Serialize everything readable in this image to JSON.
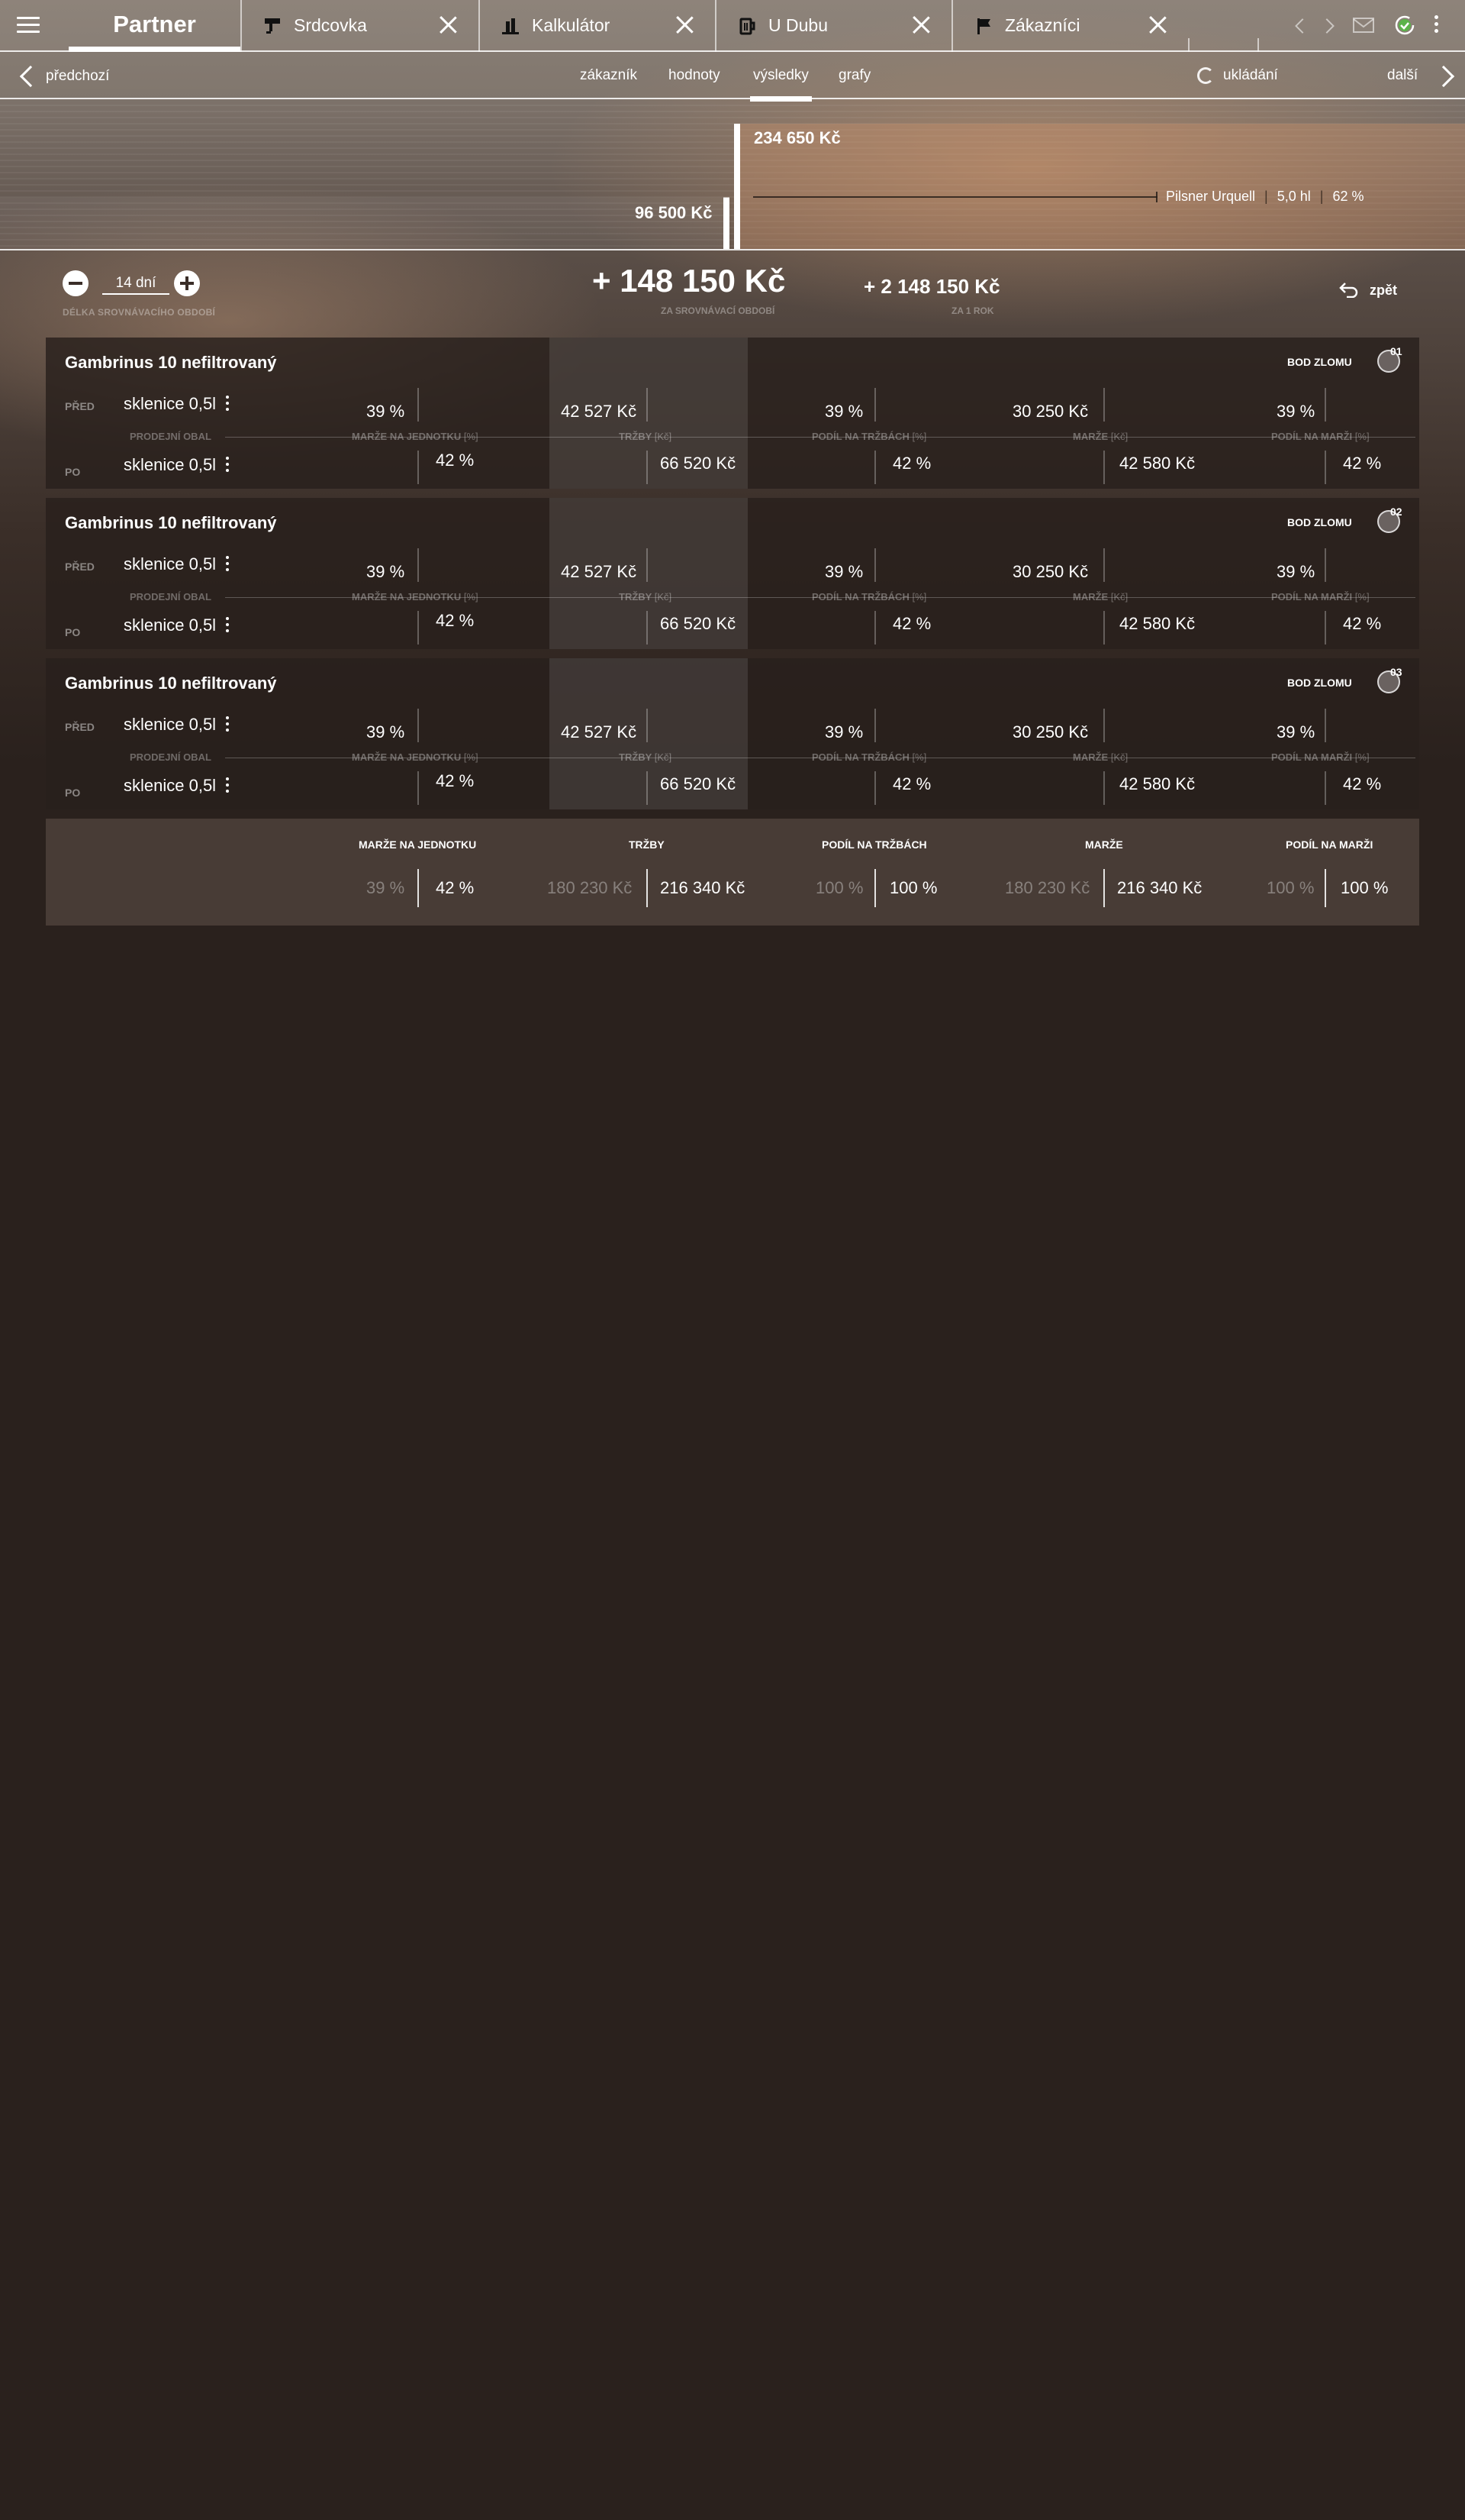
{
  "app": {
    "brand": "Partner",
    "tabs": [
      {
        "label": "Srdcovka",
        "icon": "tap-icon"
      },
      {
        "label": "Kalkulátor",
        "icon": "bar-chart-icon"
      },
      {
        "label": "U Dubu",
        "icon": "beer-mug-icon"
      },
      {
        "label": "Zákazníci",
        "icon": "flag-icon"
      }
    ],
    "header_icons": [
      "chevron-left-icon",
      "chevron-right-icon",
      "mail-icon",
      "sync-check-icon",
      "more-vertical-icon"
    ]
  },
  "subnav": {
    "prev_label": "předchozí",
    "items": [
      {
        "label": "zákazník",
        "active": false
      },
      {
        "label": "hodnoty",
        "active": false
      },
      {
        "label": "výsledky",
        "active": true
      },
      {
        "label": "grafy",
        "active": false
      }
    ],
    "saving_label": "ukládání",
    "next_label": "další"
  },
  "chart": {
    "before_value": "96 500 Kč",
    "after_value": "234 650 Kč",
    "before_amount": 96500,
    "after_amount": 234650,
    "legend": {
      "product": "Pilsner Urquell",
      "volume": "5,0 hl",
      "share": "62 %"
    }
  },
  "summary": {
    "period_value": "14 dní",
    "period_caption": "DÉLKA SROVNÁVACÍHO OBDOBÍ",
    "delta_value": "+ 148 150 Kč",
    "delta_caption": "ZA SROVNÁVACÍ OBDOBÍ",
    "year_value": "+ 2 148 150 Kč",
    "year_caption": "ZA 1 ROK",
    "back_label": "zpět"
  },
  "columns": {
    "packaging": "PRODEJNÍ OBAL",
    "margin_unit": "MARŽE NA JEDNOTKU",
    "margin_unit_suffix": "[%]",
    "revenue": "TRŽBY",
    "revenue_suffix": "[Kč]",
    "revenue_share": "PODÍL NA TRŽBÁCH",
    "revenue_share_suffix": "[%]",
    "margin": "MARŽE",
    "margin_suffix": "[Kč]",
    "margin_share": "PODÍL NA MARŽI",
    "margin_share_suffix": "[%]"
  },
  "cards": [
    {
      "number": "01",
      "name": "Gambrinus 10 nefiltrovaný",
      "bep_label": "BOD ZLOMU",
      "before": {
        "tag": "PŘED",
        "pack": "sklenice 0,5l",
        "margin_unit": "39 %",
        "revenue": "42 527 Kč",
        "revenue_share": "39 %",
        "margin": "30 250 Kč",
        "margin_share": "39 %"
      },
      "after": {
        "tag": "PO",
        "pack": "sklenice 0,5l",
        "margin_unit": "42 %",
        "revenue": "66 520 Kč",
        "revenue_share": "42 %",
        "margin": "42 580 Kč",
        "margin_share": "42 %"
      }
    },
    {
      "number": "02",
      "name": "Gambrinus 10 nefiltrovaný",
      "bep_label": "BOD ZLOMU",
      "before": {
        "tag": "PŘED",
        "pack": "sklenice 0,5l",
        "margin_unit": "39 %",
        "revenue": "42 527 Kč",
        "revenue_share": "39 %",
        "margin": "30 250 Kč",
        "margin_share": "39 %"
      },
      "after": {
        "tag": "PO",
        "pack": "sklenice 0,5l",
        "margin_unit": "42 %",
        "revenue": "66 520 Kč",
        "revenue_share": "42 %",
        "margin": "42 580 Kč",
        "margin_share": "42 %"
      }
    },
    {
      "number": "03",
      "name": "Gambrinus 10 nefiltrovaný",
      "bep_label": "BOD ZLOMU",
      "before": {
        "tag": "PŘED",
        "pack": "sklenice 0,5l",
        "margin_unit": "39 %",
        "revenue": "42 527 Kč",
        "revenue_share": "39 %",
        "margin": "30 250 Kč",
        "margin_share": "39 %"
      },
      "after": {
        "tag": "PO",
        "pack": "sklenice 0,5l",
        "margin_unit": "42 %",
        "revenue": "66 520 Kč",
        "revenue_share": "42 %",
        "margin": "42 580 Kč",
        "margin_share": "42 %"
      }
    }
  ],
  "totals": {
    "headers": {
      "margin_unit": "MARŽE NA JEDNOTKU",
      "revenue": "TRŽBY",
      "revenue_share": "PODÍL NA TRŽBÁCH",
      "margin": "MARŽE",
      "margin_share": "PODÍL NA MARŽI"
    },
    "before": {
      "margin_unit": "39 %",
      "revenue": "180 230 Kč",
      "revenue_share": "100 %",
      "margin": "180 230 Kč",
      "margin_share": "100 %"
    },
    "after": {
      "margin_unit": "42 %",
      "revenue": "216 340 Kč",
      "revenue_share": "100 %",
      "margin": "216 340 Kč",
      "margin_share": "100 %"
    }
  }
}
